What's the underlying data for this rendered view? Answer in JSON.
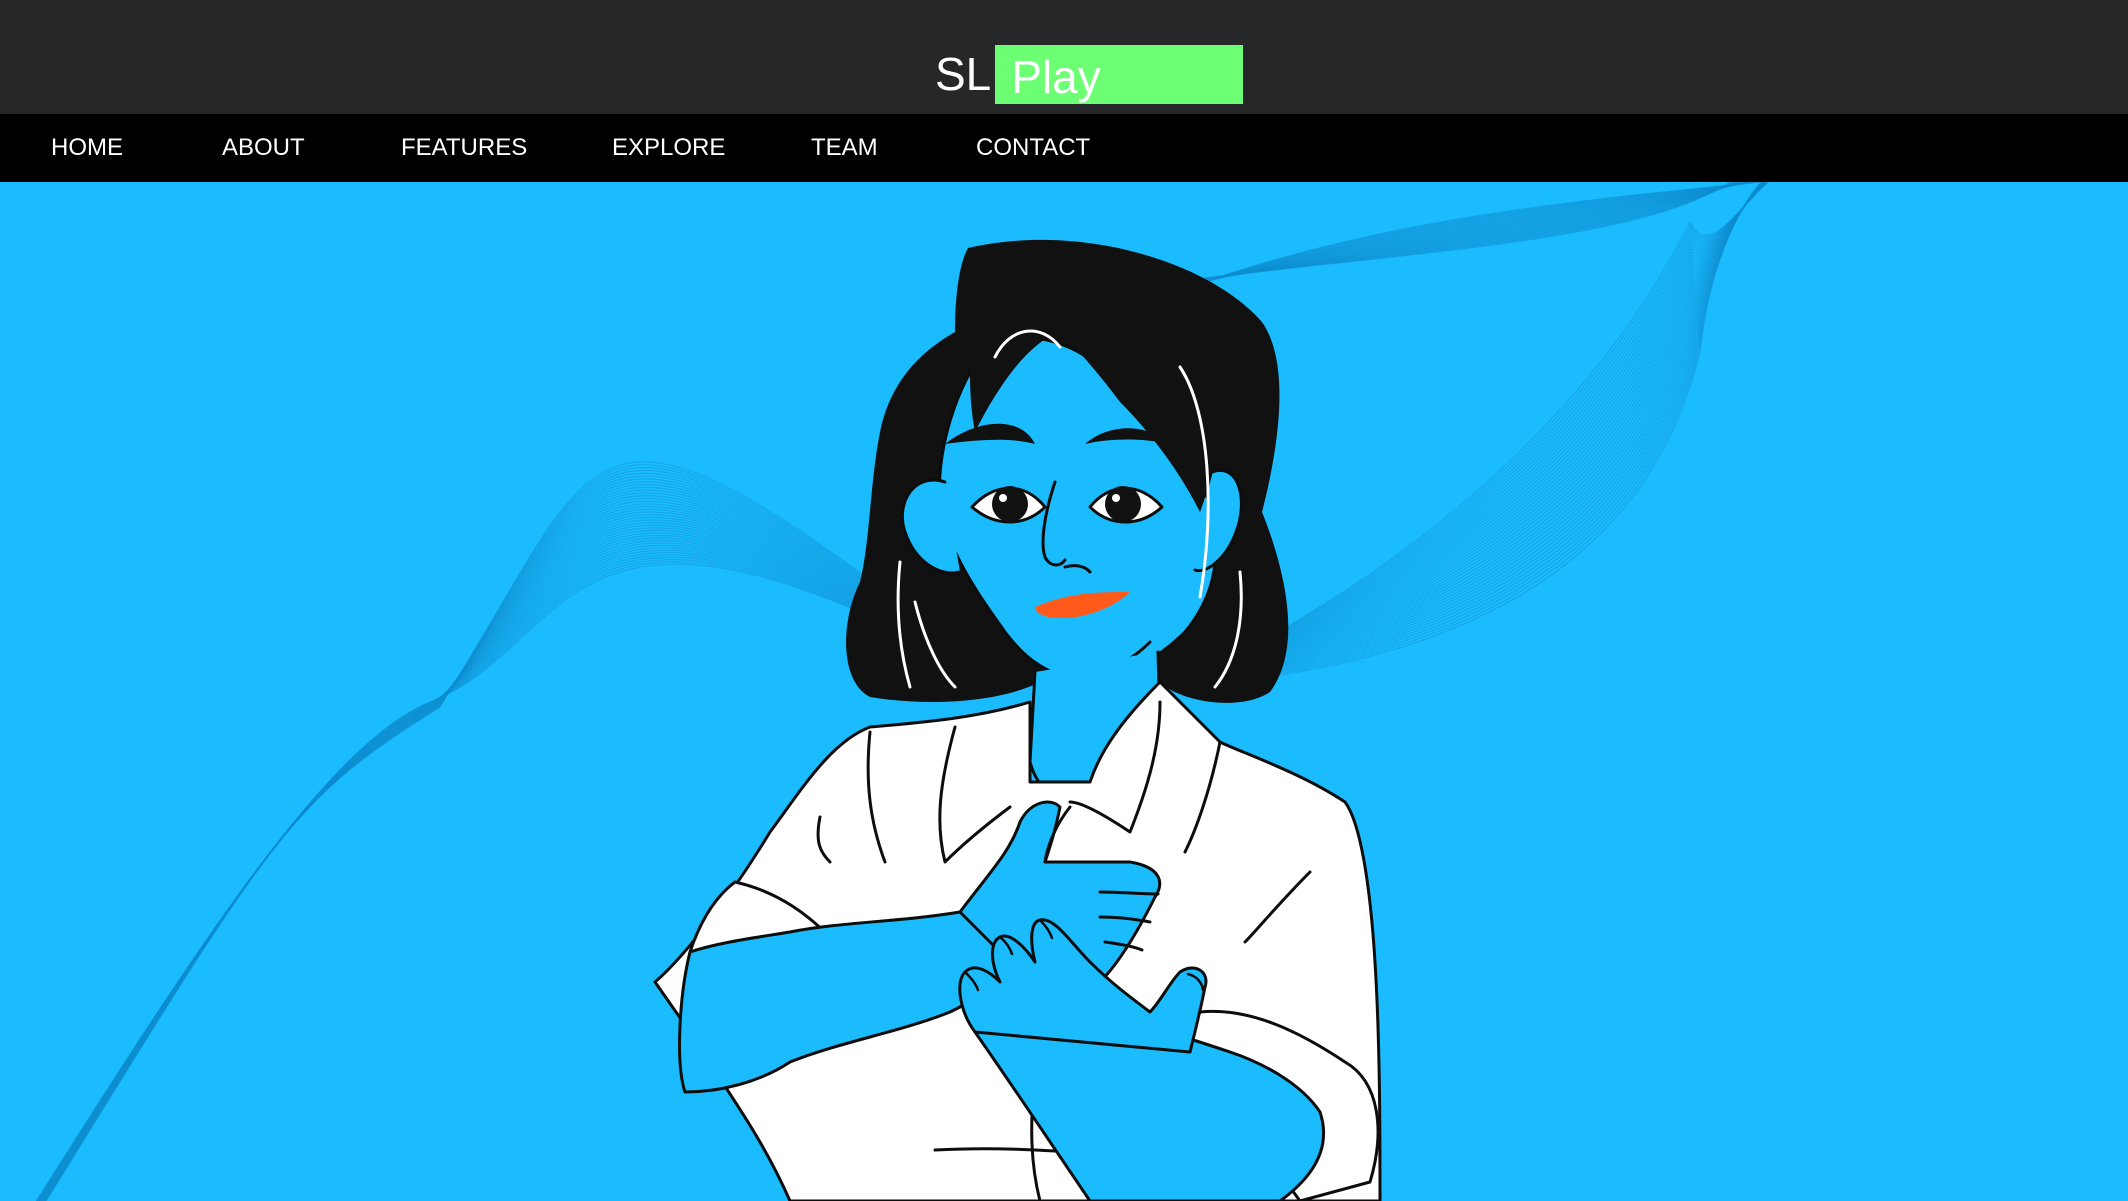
{
  "header": {
    "logo": {
      "prefix": "SL",
      "highlight": "Play"
    }
  },
  "nav": {
    "items": [
      {
        "id": "home",
        "label": "HOME"
      },
      {
        "id": "about",
        "label": "ABOUT"
      },
      {
        "id": "features",
        "label": "FEATURES"
      },
      {
        "id": "explore",
        "label": "EXPLORE"
      },
      {
        "id": "team",
        "label": "TEAM"
      },
      {
        "id": "contact",
        "label": "CONTACT"
      }
    ]
  },
  "hero": {
    "illustration": "woman-signing-illustration",
    "background_decoration": "wave-line-pattern"
  },
  "colors": {
    "topbar_bg": "#262729",
    "navbar_bg": "#000000",
    "hero_bg": "#1bbcfe",
    "logo_highlight": "#6cfe73",
    "hair": "#111111",
    "skin": "#1bbcfe",
    "shirt": "#ffffff",
    "lips": "#ff5a1a",
    "outline": "#0d0d0d"
  }
}
